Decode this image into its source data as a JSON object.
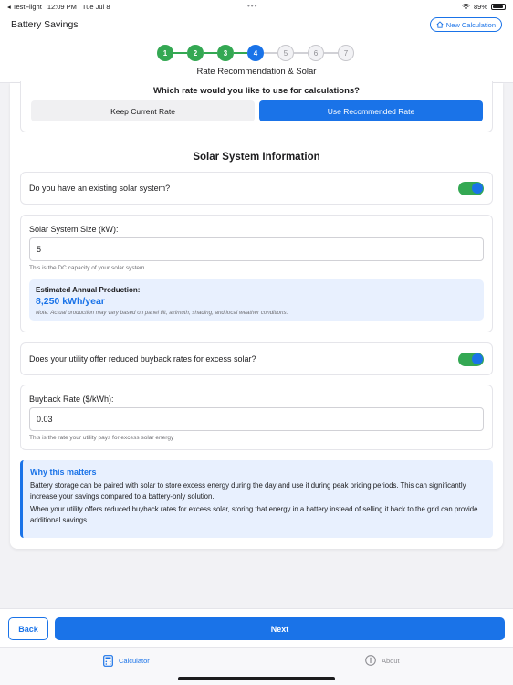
{
  "status_bar": {
    "back_app": "◂ TestFlight",
    "time": "12:09 PM",
    "date": "Tue Jul 8",
    "battery": "89%",
    "battery_level": 0.89
  },
  "header": {
    "title": "Battery Savings",
    "new_calc_label": "New Calculation"
  },
  "stepper": {
    "steps": [
      {
        "label": "1",
        "state": "done"
      },
      {
        "label": "2",
        "state": "done"
      },
      {
        "label": "3",
        "state": "done"
      },
      {
        "label": "4",
        "state": "current"
      },
      {
        "label": "5",
        "state": "todo"
      },
      {
        "label": "6",
        "state": "todo"
      },
      {
        "label": "7",
        "state": "todo"
      }
    ],
    "title": "Rate Recommendation & Solar"
  },
  "rate": {
    "question": "Which rate would you like to use for calculations?",
    "keep_label": "Keep Current Rate",
    "recommend_label": "Use Recommended Rate"
  },
  "solar": {
    "section_title": "Solar System Information",
    "existing_question": "Do you have an existing solar system?",
    "existing_toggle": true,
    "size_label": "Solar System Size (kW):",
    "size_value": "5",
    "size_helper": "This is the DC capacity of your solar system",
    "estimate_label": "Estimated Annual Production:",
    "estimate_value": "8,250 kWh/year",
    "estimate_note": "Note: Actual production may vary based on panel tilt, azimuth, shading, and local weather conditions.",
    "buyback_question": "Does your utility offer reduced buyback rates for excess solar?",
    "buyback_toggle": true,
    "buyback_label": "Buyback Rate ($/kWh):",
    "buyback_value": "0.03",
    "buyback_helper": "This is the rate your utility pays for excess solar energy"
  },
  "why": {
    "title": "Why this matters",
    "paragraph1": "Battery storage can be paired with solar to store excess energy during the day and use it during peak pricing periods. This can significantly increase your savings compared to a battery-only solution.",
    "paragraph2": "When your utility offers reduced buyback rates for excess solar, storing that energy in a battery instead of selling it back to the grid can provide additional savings."
  },
  "footer": {
    "back_label": "Back",
    "next_label": "Next"
  },
  "tabs": {
    "calculator_label": "Calculator",
    "about_label": "About"
  },
  "colors": {
    "accent": "#1a73e8",
    "success": "#34a853"
  }
}
